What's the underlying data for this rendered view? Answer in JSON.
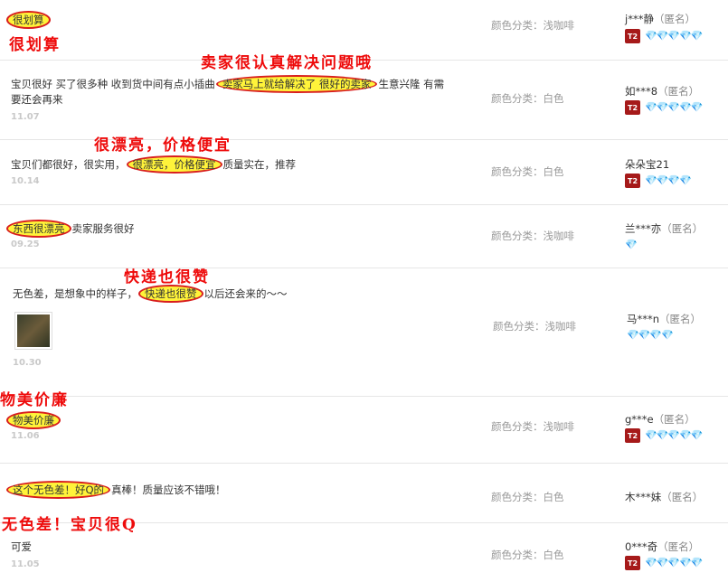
{
  "sku_label": "颜色分类：",
  "reviews": [
    {
      "pre": "",
      "hl": "很划算",
      "post": "",
      "line2": "",
      "date": "",
      "sku": "浅咖啡",
      "user": "j***静",
      "anon": "（匿名）",
      "badge": "T2",
      "hearts": "💎💎💎💎💎"
    },
    {
      "pre": "宝贝很好 买了很多种 收到货中间有点小插曲",
      "hl": "卖家马上就给解决了 很好的卖家",
      "post": "生意兴隆 有需",
      "line2": "要还会再来",
      "date": "11.07",
      "sku": "白色",
      "user": "如***8",
      "anon": "（匿名）",
      "badge": "T2",
      "hearts": "💎💎💎💎💎"
    },
    {
      "pre": "宝贝们都很好，很实用，",
      "hl": "很漂亮，价格便宜",
      "post": "质量实在，推荐",
      "line2": "",
      "date": "10.14",
      "sku": "白色",
      "user": "朵朵宝21",
      "anon": "",
      "badge": "T2",
      "hearts": "💎💎💎💎"
    },
    {
      "pre": "",
      "hl": "东西很漂亮",
      "post": "卖家服务很好",
      "line2": "",
      "date": "09.25",
      "sku": "浅咖啡",
      "user": "兰***亦",
      "anon": "（匿名）",
      "badge": "",
      "hearts": "💎"
    },
    {
      "pre": "无色差，是想象中的样子，",
      "hl": "快递也很赞",
      "post": "以后还会来的～～",
      "line2": "",
      "date": "10.30",
      "sku": "浅咖啡",
      "user": "马***n",
      "anon": "（匿名）",
      "badge": "",
      "hearts": "💎💎💎💎"
    },
    {
      "pre": "",
      "hl": "物美价廉",
      "post": "",
      "line2": "",
      "date": "11.06",
      "sku": "浅咖啡",
      "user": "g***e",
      "anon": "（匿名）",
      "badge": "T2",
      "hearts": "💎💎💎💎💎"
    },
    {
      "pre": "",
      "hl": "这个无色差！好Q的",
      "post": "真棒！质量应该不错哦！",
      "line2": "",
      "date": "",
      "sku": "白色",
      "user": "木***妹",
      "anon": "（匿名）",
      "badge": "",
      "hearts": ""
    },
    {
      "pre": "可爱",
      "hl": "",
      "post": "",
      "line2": "",
      "date": "11.05",
      "sku": "白色",
      "user": "0***奇",
      "anon": "（匿名）",
      "badge": "T2",
      "hearts": "💎💎💎💎💎"
    }
  ],
  "annotations": [
    "很划算",
    "卖家很认真解决问题哦",
    "很漂亮，价格便宜",
    "快递也很赞",
    "物美价廉",
    "无色差！宝贝很Q"
  ],
  "colors": {
    "annotation": "#ee0b0b",
    "highlight": "#fff33a",
    "circle": "#d81e1e",
    "badge": "#a61a1a"
  }
}
